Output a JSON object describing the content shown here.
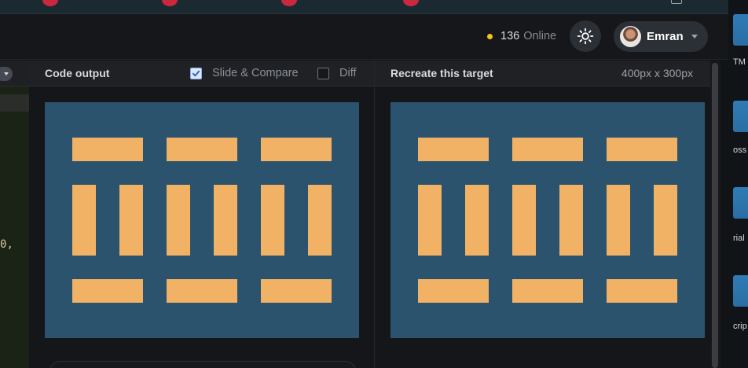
{
  "header": {
    "online_count": "136",
    "online_label": "Online",
    "username": "Emran",
    "status_dot_color": "#f5c518",
    "theme_icon": "sun-icon"
  },
  "code_panel": {
    "visible_fragment": "0",
    "visible_punctuation": ","
  },
  "output_panel": {
    "title": "Code output",
    "slide_compare_label": "Slide & Compare",
    "slide_compare_checked": true,
    "diff_label": "Diff",
    "diff_checked": false
  },
  "target_panel": {
    "title": "Recreate this target",
    "dimensions": "400px x 300px"
  },
  "canvas": {
    "background_color": "#2b536d",
    "bar_color": "#f1b266"
  },
  "right_strip": {
    "fragments": [
      "TM",
      "oss",
      "rial",
      "crip"
    ]
  }
}
